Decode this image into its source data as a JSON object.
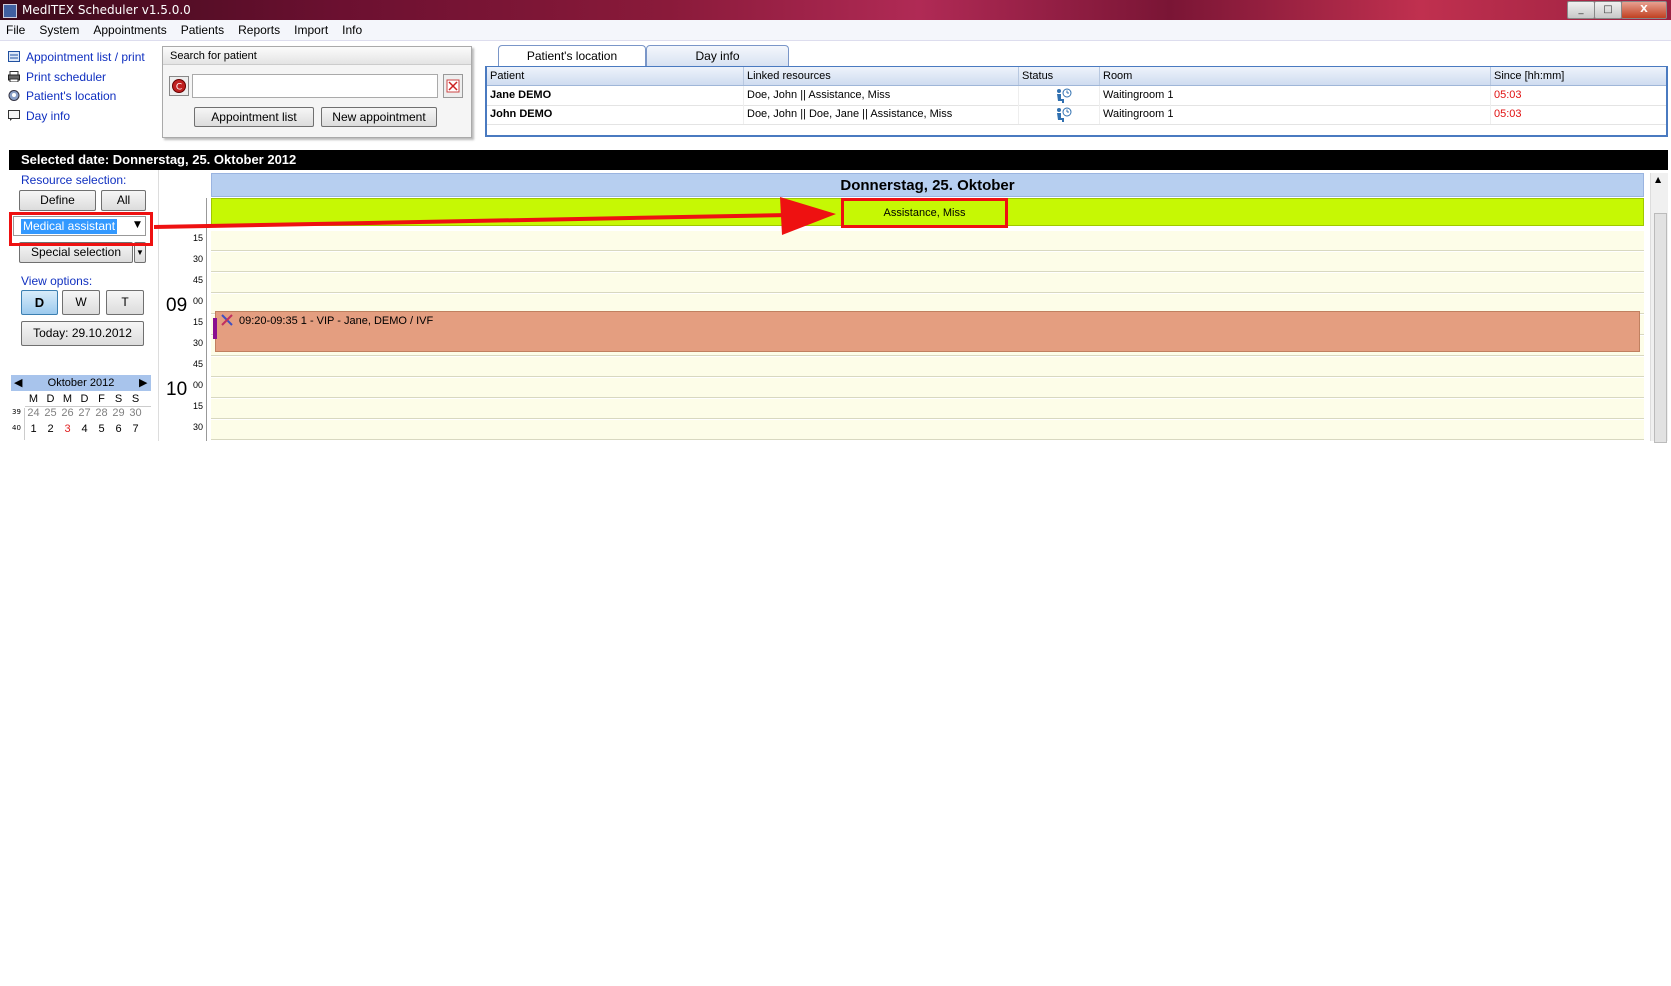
{
  "window": {
    "title": "MedITEX  Scheduler v1.5.0.0",
    "min": "_",
    "max": "□",
    "close": "X"
  },
  "menu": [
    "File",
    "System",
    "Appointments",
    "Patients",
    "Reports",
    "Import",
    "Info"
  ],
  "nav_links": [
    {
      "label": "Appointment list / print",
      "icon": "list-icon"
    },
    {
      "label": "Print scheduler",
      "icon": "printer-icon"
    },
    {
      "label": "Patient's location",
      "icon": "location-icon"
    },
    {
      "label": "Day info",
      "icon": "note-icon"
    }
  ],
  "search": {
    "header": "Search for patient",
    "value": "",
    "appointment_list_btn": "Appointment list",
    "new_appointment_btn": "New appointment"
  },
  "tabs": {
    "patients_location": "Patient's location",
    "day_info": "Day info"
  },
  "location_table": {
    "headers": [
      "Patient",
      "Linked resources",
      "Status",
      "Room",
      "Since [hh:mm]"
    ],
    "rows": [
      {
        "patient": "Jane DEMO",
        "linked": "Doe, John || Assistance, Miss",
        "status_icon": "waiting-icon",
        "room": "Waitingroom 1",
        "since": "05:03"
      },
      {
        "patient": "John DEMO",
        "linked": "Doe, John || Doe, Jane || Assistance, Miss",
        "status_icon": "waiting-icon",
        "room": "Waitingroom 1",
        "since": "05:03"
      }
    ]
  },
  "selected_date": "Selected date: Donnerstag, 25. Oktober 2012",
  "resource_selection": {
    "label": "Resource selection:",
    "define_btn": "Define",
    "all_btn": "All",
    "selected": "Medical assistant",
    "special_btn": "Special selection"
  },
  "view_options": {
    "label": "View options:",
    "day": "D",
    "week": "W",
    "team": "T",
    "today_btn": "Today: 29.10.2012"
  },
  "mini_calendar": {
    "month": "Oktober 2012",
    "weekdays": [
      "M",
      "D",
      "M",
      "D",
      "F",
      "S",
      "S"
    ],
    "weeks": [
      {
        "num": "39",
        "days": [
          "24",
          "25",
          "26",
          "27",
          "28",
          "29",
          "30"
        ]
      },
      {
        "num": "40",
        "days": [
          "1",
          "2",
          "3",
          "4",
          "5",
          "6",
          "7"
        ]
      }
    ],
    "highlight_day": "3",
    "highlight_color": "#e02020"
  },
  "schedule": {
    "day_title": "Donnerstag, 25. Oktober",
    "resource": "Assistance, Miss",
    "resource_color": "#c6f804",
    "slots": [
      {
        "hour": "",
        "min": "15"
      },
      {
        "hour": "",
        "min": "30"
      },
      {
        "hour": "",
        "min": "45"
      },
      {
        "hour": "09",
        "min": "00"
      },
      {
        "hour": "",
        "min": "15"
      },
      {
        "hour": "",
        "min": "30"
      },
      {
        "hour": "",
        "min": "45"
      },
      {
        "hour": "10",
        "min": "00"
      },
      {
        "hour": "",
        "min": "15"
      },
      {
        "hour": "",
        "min": "30"
      }
    ],
    "appointment": {
      "text": "09:20-09:35 1 - VIP - Jane, DEMO / IVF",
      "color": "#e49e80"
    }
  }
}
